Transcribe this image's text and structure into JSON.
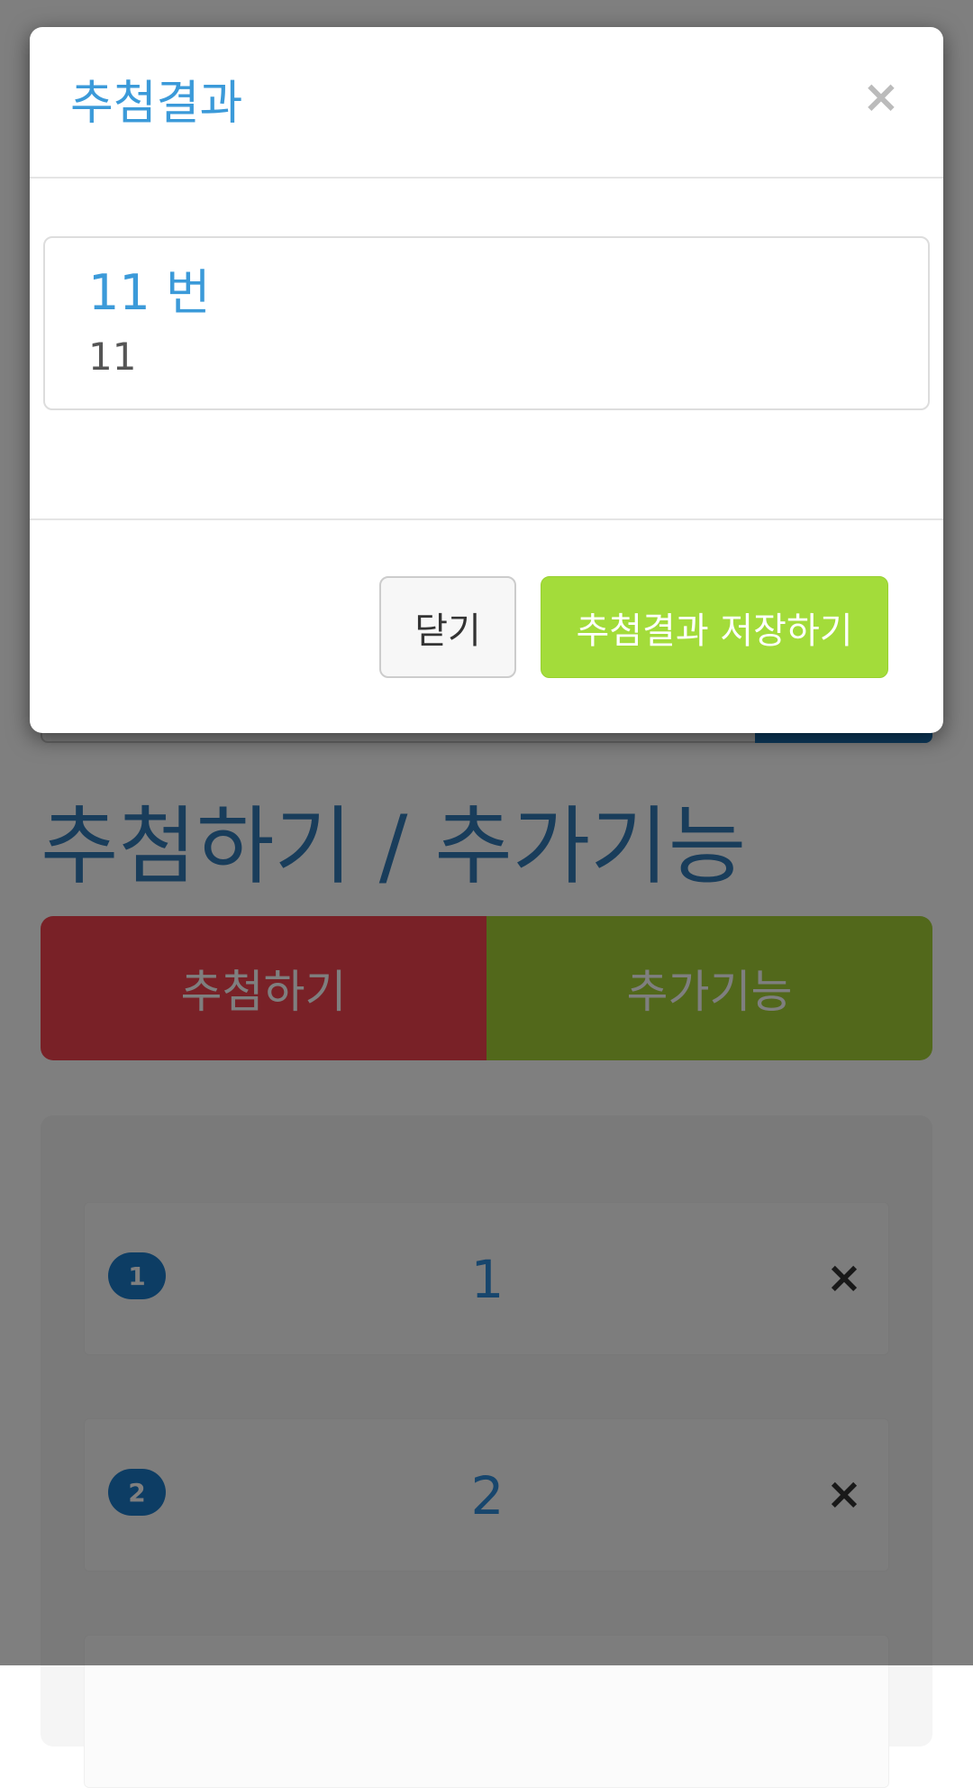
{
  "background": {
    "section_title": "추첨하기 / 추가기능",
    "tabs": [
      {
        "label": "추첨하기"
      },
      {
        "label": "추가기능"
      }
    ],
    "list_items": [
      {
        "badge": "1",
        "value": "1"
      },
      {
        "badge": "2",
        "value": "2"
      }
    ],
    "colors": {
      "tab_draw": "#f3424f",
      "tab_extra": "#a4d037",
      "badge": "#1b7ac9"
    }
  },
  "modal": {
    "title": "추첨결과",
    "close_icon": "close-icon",
    "result": {
      "heading": "11 번",
      "sub": "11"
    },
    "footer": {
      "close_label": "닫기",
      "save_label": "추첨결과 저장하기"
    },
    "colors": {
      "title": "#3b9ad9",
      "save_button": "#a3dc3a"
    }
  }
}
